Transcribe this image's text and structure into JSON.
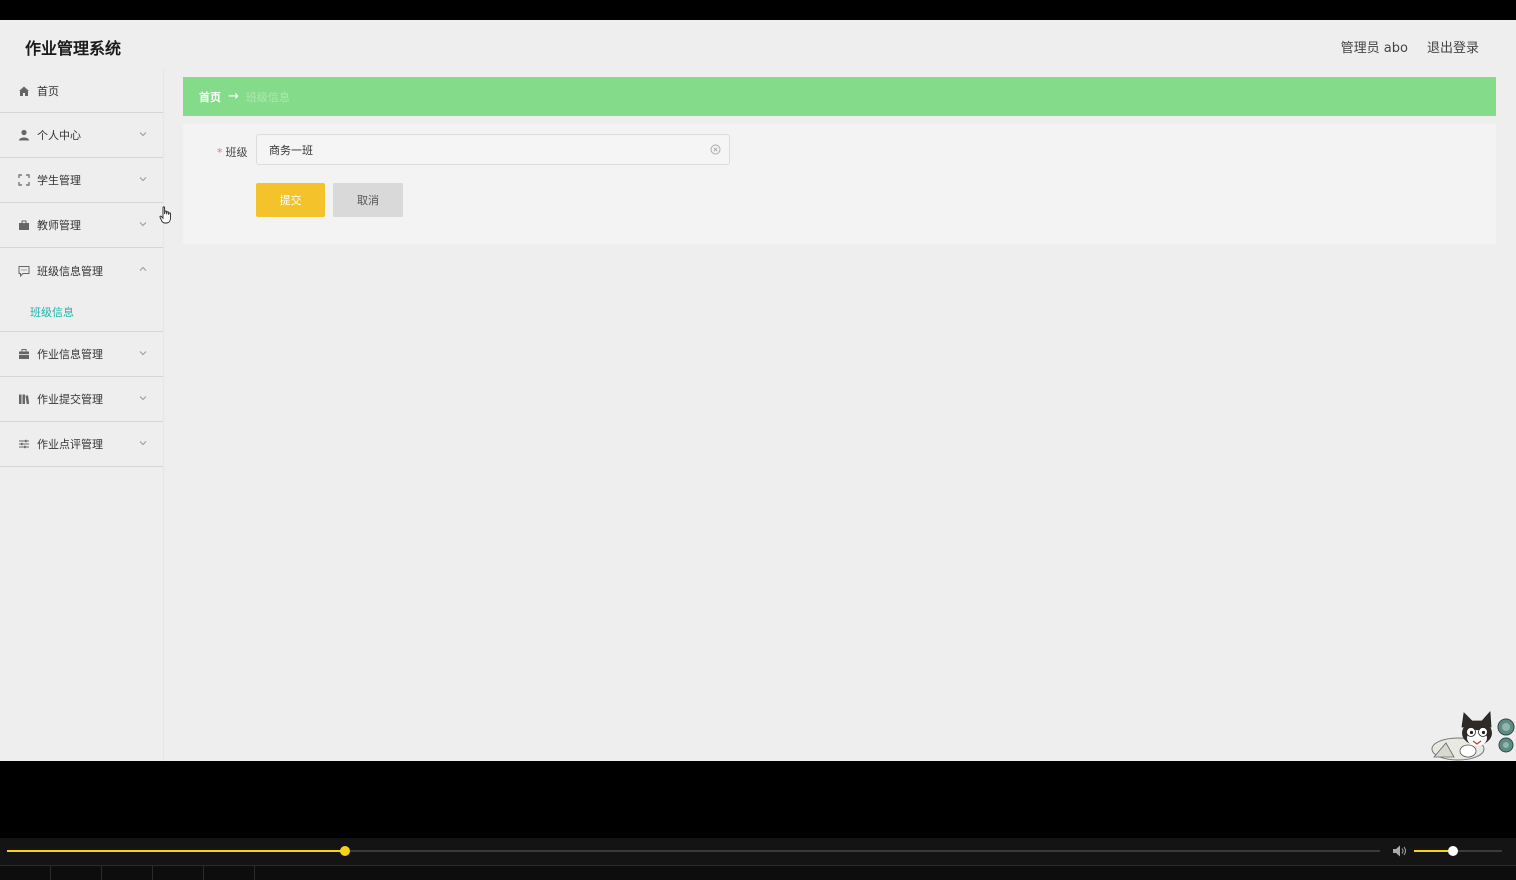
{
  "header": {
    "brand": "作业管理系统",
    "user_label": "管理员 abo",
    "logout_label": "退出登录"
  },
  "sidebar": {
    "items": [
      {
        "label": "首页",
        "icon": "home-icon"
      },
      {
        "label": "个人中心",
        "icon": "user-icon"
      },
      {
        "label": "学生管理",
        "icon": "expand-icon"
      },
      {
        "label": "教师管理",
        "icon": "suitcase-icon"
      },
      {
        "label": "班级信息管理",
        "icon": "chat-icon",
        "expanded": true
      },
      {
        "label": "作业信息管理",
        "icon": "briefcase-icon"
      },
      {
        "label": "作业提交管理",
        "icon": "books-icon"
      },
      {
        "label": "作业点评管理",
        "icon": "sliders-icon"
      }
    ],
    "submenu": {
      "label": "班级信息"
    }
  },
  "breadcrumb": {
    "home": "首页",
    "separator": "→",
    "current": "班级信息"
  },
  "form": {
    "required_mark": "*",
    "class_label": "班级",
    "class_value": "商务一班",
    "submit_label": "提交",
    "cancel_label": "取消"
  },
  "player": {
    "progress": 0.246,
    "volume": 0.44
  },
  "colors": {
    "breadcrumb_bg": "#84db89",
    "submit_bg": "#f4c22b",
    "accent": "#1fb5ad",
    "player_accent": "#f7d117"
  }
}
